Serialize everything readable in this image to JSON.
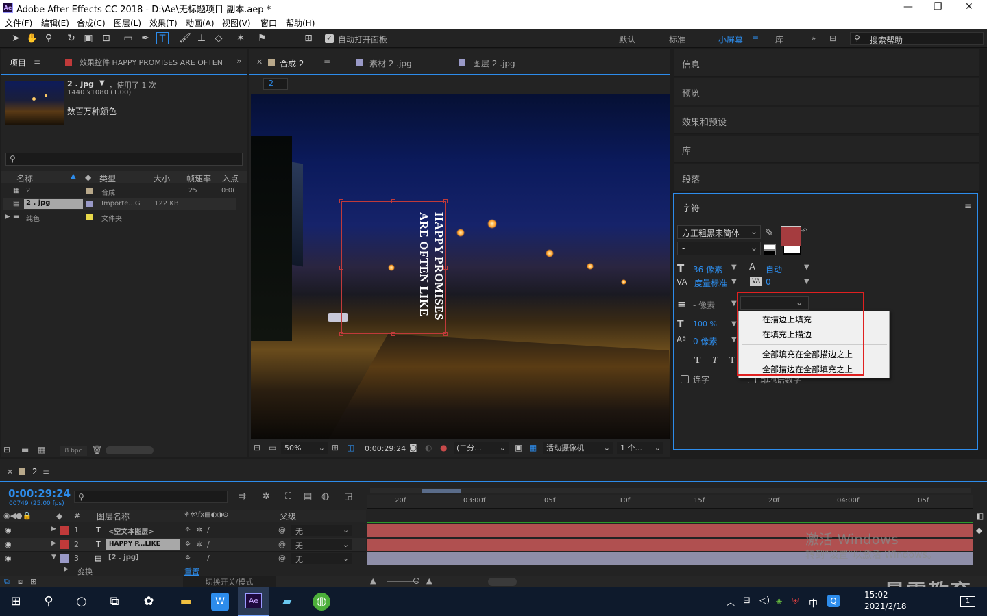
{
  "app": {
    "title": "Adobe After Effects CC 2018 - D:\\Ae\\无标题项目 副本.aep *",
    "logo": "Ae"
  },
  "menu": [
    "文件(F)",
    "编辑(E)",
    "合成(C)",
    "图层(L)",
    "效果(T)",
    "动画(A)",
    "视图(V)",
    "窗口",
    "帮助(H)"
  ],
  "toolbar": {
    "auto_open_label": "自动打开面板",
    "workspaces": [
      "默认",
      "标准",
      "小屏幕",
      "库"
    ],
    "active_workspace": "小屏幕",
    "search_placeholder": "搜索帮助"
  },
  "project_panel": {
    "tab_project": "项目",
    "tab_effects": "效果控件 HAPPY PROMISES ARE OFTEN",
    "asset_name": "2 . jpg",
    "asset_used": "，使用了 1 次",
    "asset_dims": "1440 x1080 (1.00)",
    "asset_colors": "数百万种颜色",
    "columns": [
      "名称",
      "类型",
      "大小",
      "帧速率",
      "入点"
    ],
    "rows": [
      {
        "name": "2",
        "type": "合成",
        "size": "",
        "fps": "25",
        "in": "0:0("
      },
      {
        "name": "2 . jpg",
        "type": "Importe...G",
        "size": "122 KB",
        "fps": "",
        "in": ""
      },
      {
        "name": "纯色",
        "type": "文件夹",
        "size": "",
        "fps": "",
        "in": ""
      }
    ],
    "bpc": "8 bpc"
  },
  "comp_panel": {
    "tabs": [
      "合成 2",
      "素材 2 .jpg",
      "图层 2 .jpg"
    ],
    "comp_label": "2",
    "text_line1": "HAPPY PROMISES",
    "text_line2": "ARE OFTEN LIKE",
    "zoom": "50%",
    "timecode": "0:00:29:24",
    "resolution": "(二分...",
    "camera": "活动摄像机",
    "views": "1 个..."
  },
  "right_panel": {
    "items": [
      "信息",
      "预览",
      "效果和预设",
      "库",
      "段落"
    ],
    "char_title": "字符",
    "font_family": "方正粗黑宋简体",
    "font_style": "-",
    "font_size": "36 像素",
    "leading": "自动",
    "kerning": "度量标准",
    "tracking": "0",
    "stroke_width": "- 像素",
    "vert_scale": "100 %",
    "baseline": "0 像素",
    "ligature": "连字",
    "hindi": "印地语数字",
    "dropdown_options": [
      "在描边上填充",
      "在填充上描边",
      "全部填充在全部描边之上",
      "全部描边在全部填充之上"
    ]
  },
  "timeline": {
    "comp_tab": "2",
    "timecode": "0:00:29:24",
    "frame_info": "00749 (25.00 fps)",
    "column_layer_name": "图层名称",
    "column_parent": "父级",
    "ruler": [
      "20f",
      "03:00f",
      "05f",
      "10f",
      "15f",
      "20f",
      "04:00f",
      "05f"
    ],
    "layers": [
      {
        "num": "1",
        "name": "<空文本图层>",
        "parent": "无"
      },
      {
        "num": "2",
        "name": "HAPPY P...LIKE",
        "parent": "无"
      },
      {
        "num": "3",
        "name": "[2 . jpg]",
        "parent": "无"
      }
    ],
    "transform_label": "变换",
    "reset_label": "重置",
    "toggle_label": "切换开关/模式"
  },
  "watermark": {
    "line1": "激活 Windows",
    "line2": "转到\"设置\"以激活 Windows。",
    "brand": "最需教育"
  },
  "taskbar": {
    "time": "15:02",
    "date": "2021/2/18",
    "ime": "中",
    "notif": "1"
  }
}
